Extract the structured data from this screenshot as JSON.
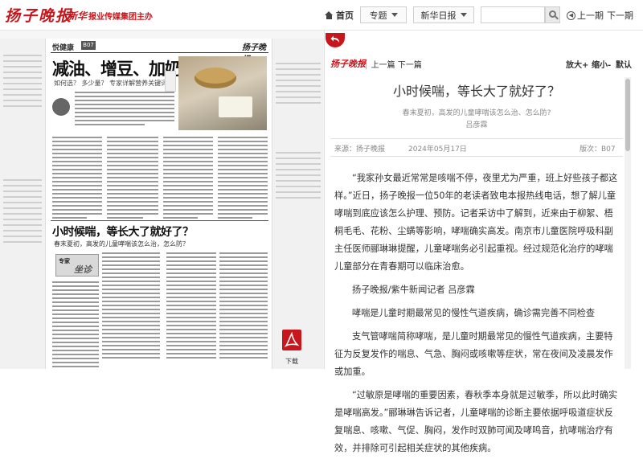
{
  "header": {
    "logo": "扬子晚报",
    "sponsor_brand": "新华",
    "sponsor_text": "报业传媒集团主办",
    "home_label": "首页",
    "channel_label": "专题",
    "newspaper_label": "新华日报",
    "search_placeholder": "",
    "prev_label": "上一期",
    "next_label": "下一期"
  },
  "paper_page": {
    "section": "悦健康",
    "page_no": "B07",
    "logo": "扬子晚报",
    "headline_1": "减油、增豆、加奶！",
    "subhead_1": "如何选？ 多少量？ 专家详解营养关键词",
    "headline_2": "小时候喘，等长大了就好了？",
    "subhead_2": "春末夏初，高发的儿童哮喘该怎么治，怎么防？",
    "column_badge_1": "专家",
    "column_badge_2": "坐诊",
    "download_label": "下载"
  },
  "reader": {
    "logo": "扬子晚报",
    "prev_article": "上一篇",
    "next_article": "下一篇",
    "zoom_in": "放大+",
    "zoom_out": "缩小-",
    "zoom_default": "默认",
    "title": "小时候喘，等长大了就好了？",
    "subtitle": "春末夏初，高发的儿童哮喘该怎么治、怎么防?",
    "author": "吕彦霖",
    "source": "来源：扬子晚报",
    "date": "2024年05月17日",
    "page": "版次：B07",
    "paragraphs": [
      "“我家孙女最近常常是咳喘不停，夜里尤为严重，班上好些孩子都这样。”近日，扬子晚报一位50年的老读者致电本报热线电话，想了解儿童哮喘到底应该怎么护理、预防。记者采访中了解到，近来由于柳絮、梧桐毛毛、花粉、尘螨等影响，哮喘确实高发。南京市儿童医院呼吸科副主任医师郦琳琳提醒，儿童哮喘务必引起重视。经过规范化治疗的哮喘儿童部分在青春期可以临床治愈。",
      "扬子晚报/紫牛新闻记者 吕彦霖",
      "哮喘是儿童时期最常见的慢性气道疾病，确诊需完善不同检查",
      "支气管哮喘简称哮喘，是儿童时期最常见的慢性气道疾病，主要特征为反复发作的喘息、气急、胸闷或咳嗽等症状，常在夜间及凌晨发作或加重。",
      "“过敏原是哮喘的重要因素，春秋季本身就是过敏季，所以此时确实是哮喘高发。”郦琳琳告诉记者，儿童哮喘的诊断主要依据呼吸道症状反复喘息、咳嗽、气促、胸闷，发作时双肺可闻及哮鸣音，抗哮喘治疗有效，并排除可引起相关症状的其他疾病。"
    ]
  },
  "colors": {
    "brand_red": "#c8161d",
    "text": "#333333",
    "muted": "#888888"
  }
}
